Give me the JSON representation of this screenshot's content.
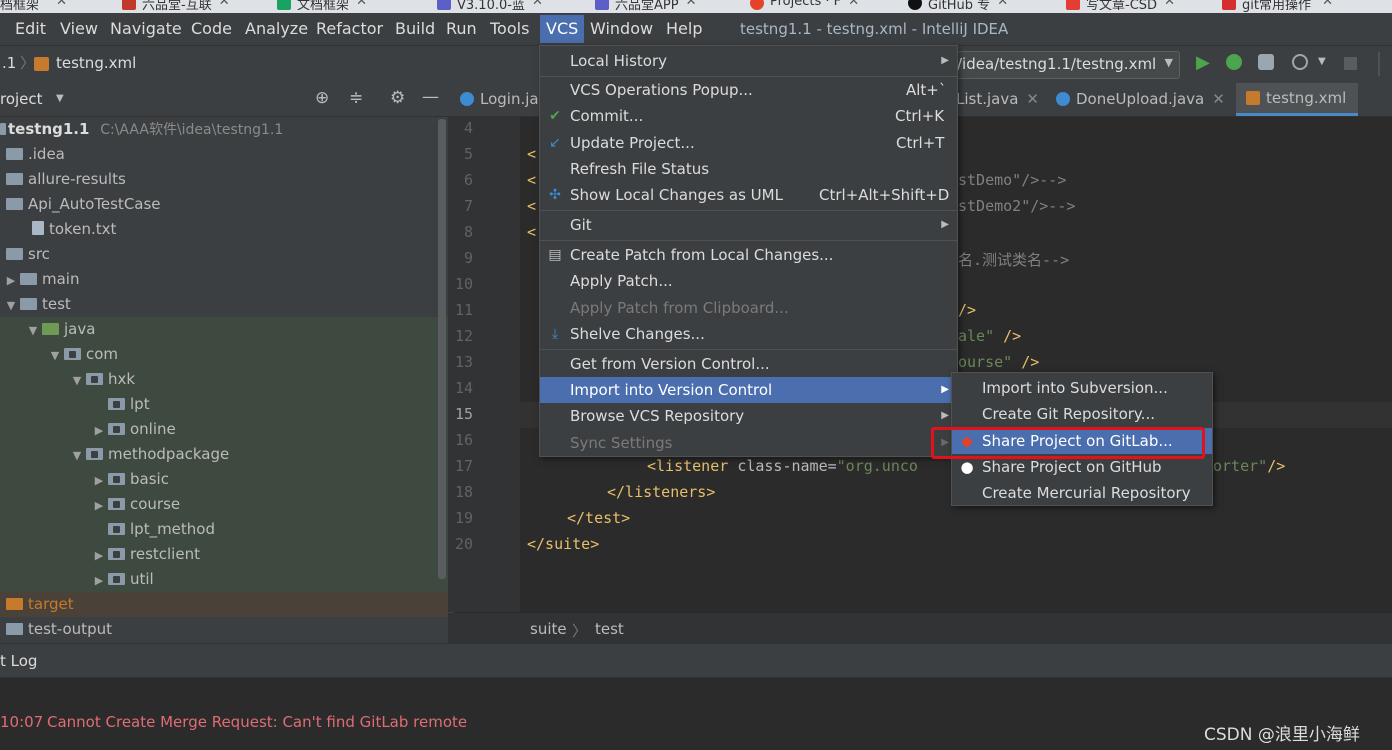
{
  "browser_tabs": [
    "档框架",
    "六品堂-互联",
    "文档框架",
    "V3.10.0-蓝",
    "六品堂APP",
    "Projects · F",
    "GitHub 专",
    "写文章-CSD",
    "git常用操作"
  ],
  "menubar": {
    "items": [
      "Edit",
      "View",
      "Navigate",
      "Code",
      "Analyze",
      "Refactor",
      "Build",
      "Run",
      "Tools",
      "VCS",
      "Window",
      "Help"
    ],
    "title": "testng1.1 - testng.xml - IntelliJ IDEA"
  },
  "navbar": {
    "project": ".1",
    "file": "testng.xml",
    "run_config": "/idea/testng1.1/testng.xml"
  },
  "project_panel": {
    "title": "roject",
    "root": {
      "name": "testng1.1",
      "path": "C:\\AAA软件\\idea\\testng1.1"
    },
    "tree": [
      ".idea",
      "allure-results",
      "Api_AutoTestCase",
      "token.txt",
      "src",
      "main",
      "test",
      "java",
      "com",
      "hxk",
      "lpt",
      "online",
      "methodpackage",
      "basic",
      "course",
      "lpt_method",
      "restclient",
      "util",
      "target",
      "test-output"
    ]
  },
  "editor_tabs": [
    "Login.ja",
    "List.java",
    "DoneUpload.java",
    "testng.xml"
  ],
  "editor": {
    "line_numbers": [
      "4",
      "5",
      "6",
      "7",
      "8",
      "9",
      "10",
      "11",
      "12",
      "13",
      "14",
      "15",
      "16",
      "17",
      "18",
      "19",
      "20"
    ],
    "frag_lt": "<",
    "frag6": "stDemo\"/>-->",
    "frag7": "stDemo2\"/>-->",
    "frag9": "名.测试类名-->",
    "frag11": "/>",
    "frag12a": "ale\"",
    "frag12b": " />",
    "frag13a": "ourse\"",
    "frag13b": " />",
    "line17_tag": "<listener ",
    "line17_attr": "class-name=",
    "line17_val": "\"org.unco",
    "line17_tail": "orter\"",
    "line17_end": "/>",
    "line18": "</listeners>",
    "line19": "</test>",
    "line20": "</suite>"
  },
  "breadcrumb": [
    "suite",
    "test"
  ],
  "bottom": {
    "title": "t Log",
    "time": "10:07",
    "message": "Cannot Create Merge Request: Can't find GitLab remote",
    "watermark": "CSDN @浪里小海鲜"
  },
  "vcs_menu": {
    "local_history": "Local History",
    "ops_popup": "VCS Operations Popup...",
    "ops_popup_sc": "Alt+`",
    "commit": "Commit...",
    "commit_sc": "Ctrl+K",
    "update": "Update Project...",
    "update_sc": "Ctrl+T",
    "refresh": "Refresh File Status",
    "show_uml": "Show Local Changes as UML",
    "show_uml_sc": "Ctrl+Alt+Shift+D",
    "git": "Git",
    "create_patch": "Create Patch from Local Changes...",
    "apply_patch": "Apply Patch...",
    "apply_clip": "Apply Patch from Clipboard...",
    "shelve": "Shelve Changes...",
    "get_vc": "Get from Version Control...",
    "import_vc": "Import into Version Control",
    "browse": "Browse VCS Repository",
    "sync": "Sync Settings"
  },
  "import_submenu": {
    "svn": "Import into Subversion...",
    "git": "Create Git Repository...",
    "gitlab": "Share Project on GitLab...",
    "github": "Share Project on GitHub",
    "hg": "Create Mercurial Repository"
  },
  "colors": {
    "highlight": "#4b6eaf",
    "annotation": "#e0121c",
    "error": "#e06c75"
  }
}
